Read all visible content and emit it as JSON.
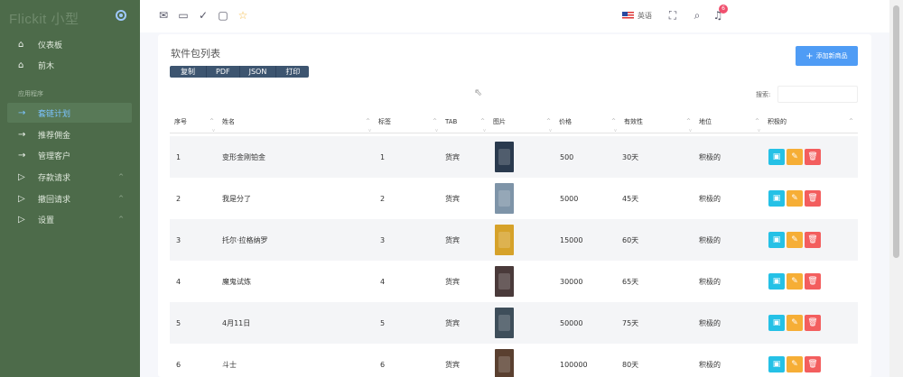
{
  "sidebar": {
    "brand": "Flickit 小型",
    "section_label": "应用程序",
    "items": [
      {
        "label": "仪表板",
        "icon": "home-icon",
        "glyph": "⌂",
        "caret": ""
      },
      {
        "label": "前木",
        "icon": "home-icon",
        "glyph": "⌂",
        "caret": ""
      },
      {
        "label": "套链计划",
        "icon": "arrow-right-icon",
        "glyph": "→",
        "caret": ""
      },
      {
        "label": "推荐佣金",
        "icon": "arrow-right-icon",
        "glyph": "→",
        "caret": ""
      },
      {
        "label": "管理客户",
        "icon": "arrow-right-icon",
        "glyph": "→",
        "caret": ""
      },
      {
        "label": "存款请求",
        "icon": "play-icon",
        "glyph": "▷",
        "caret": "^"
      },
      {
        "label": "撤回请求",
        "icon": "play-icon",
        "glyph": "▷",
        "caret": "^"
      },
      {
        "label": "设置",
        "icon": "play-icon",
        "glyph": "▷",
        "caret": "^"
      }
    ]
  },
  "topbar": {
    "icons": [
      {
        "name": "mail-icon",
        "glyph": "✉"
      },
      {
        "name": "chat-icon",
        "glyph": "▭"
      },
      {
        "name": "check-circle-icon",
        "glyph": "✓"
      },
      {
        "name": "calendar-icon",
        "glyph": "▢"
      },
      {
        "name": "star-icon",
        "glyph": "☆"
      }
    ],
    "language": "英语",
    "fullscreen_glyph": "⛶",
    "search_glyph": "⌕",
    "bell_glyph": "♫",
    "notification_count": "6"
  },
  "card": {
    "title": "软件包列表",
    "export_buttons": [
      "复制",
      "PDF",
      "JSON",
      "打印"
    ],
    "add_button": "添加新商品",
    "add_glyph": "+",
    "search_label": "搜索:",
    "search_value": ""
  },
  "table": {
    "headers": [
      "序号",
      "姓名",
      "标签",
      "TAB",
      "图片",
      "价格",
      "有效性",
      "地位",
      "积极的"
    ],
    "rows": [
      {
        "no": "1",
        "name": "变形金刚铂金",
        "tag": "1",
        "tab": "货宾",
        "price": "500",
        "validity": "30天",
        "status": "积极的",
        "poster_color": "#2a3a4e"
      },
      {
        "no": "2",
        "name": "我是分了",
        "tag": "2",
        "tab": "货宾",
        "price": "5000",
        "validity": "45天",
        "status": "积极的",
        "poster_color": "#7e94a8"
      },
      {
        "no": "3",
        "name": "托尔·拉格纳罗",
        "tag": "3",
        "tab": "货宾",
        "price": "15000",
        "validity": "60天",
        "status": "积极的",
        "poster_color": "#d6a22a"
      },
      {
        "no": "4",
        "name": "魔鬼试炼",
        "tag": "4",
        "tab": "货宾",
        "price": "30000",
        "validity": "65天",
        "status": "积极的",
        "poster_color": "#4a3a3a"
      },
      {
        "no": "5",
        "name": "4月11日",
        "tag": "5",
        "tab": "货宾",
        "price": "50000",
        "validity": "75天",
        "status": "积极的",
        "poster_color": "#3e4e5a"
      },
      {
        "no": "6",
        "name": "斗士",
        "tag": "6",
        "tab": "货宾",
        "price": "100000",
        "validity": "80天",
        "status": "积极的",
        "poster_color": "#5a4030"
      }
    ],
    "action_glyphs": {
      "view": "▣",
      "edit": "✎",
      "delete": "🗑"
    }
  }
}
